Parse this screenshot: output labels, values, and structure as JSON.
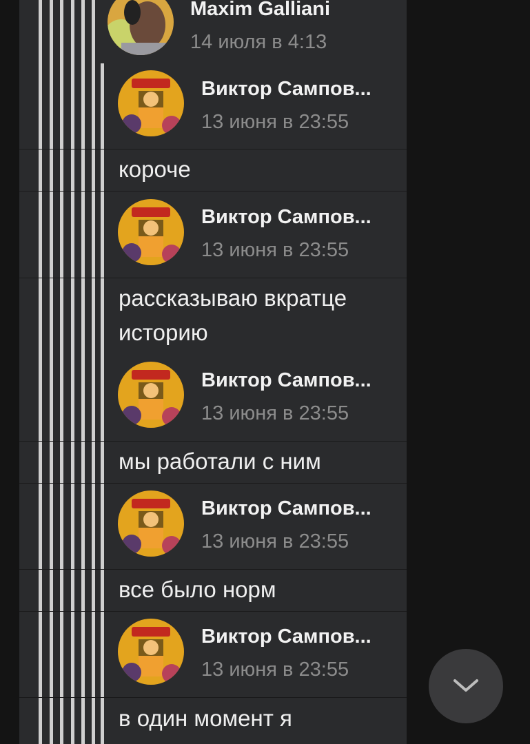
{
  "root": {
    "author": "Maxim Galliani",
    "date": "14 июля в 4:13"
  },
  "replies": [
    {
      "author": "Виктор Сампов...",
      "date": "13 июня в 23:55",
      "text": "короче"
    },
    {
      "author": "Виктор Сампов...",
      "date": "13 июня в 23:55",
      "text": "рассказываю вкратце историю"
    },
    {
      "author": "Виктор Сампов...",
      "date": "13 июня в 23:55",
      "text": "мы работали с ним"
    },
    {
      "author": "Виктор Сампов...",
      "date": "13 июня в 23:55",
      "text": "все было норм"
    },
    {
      "author": "Виктор Сампов...",
      "date": "13 июня в 23:55",
      "text": "в один момент я"
    }
  ],
  "scroll_down_button": {
    "icon": "chevron-down-icon"
  },
  "colors": {
    "background": "#141414",
    "panel": "#2a2b2d",
    "name": "#f2f2f2",
    "date": "#8c8c8c",
    "thread_rail": "#cfcfcf"
  }
}
